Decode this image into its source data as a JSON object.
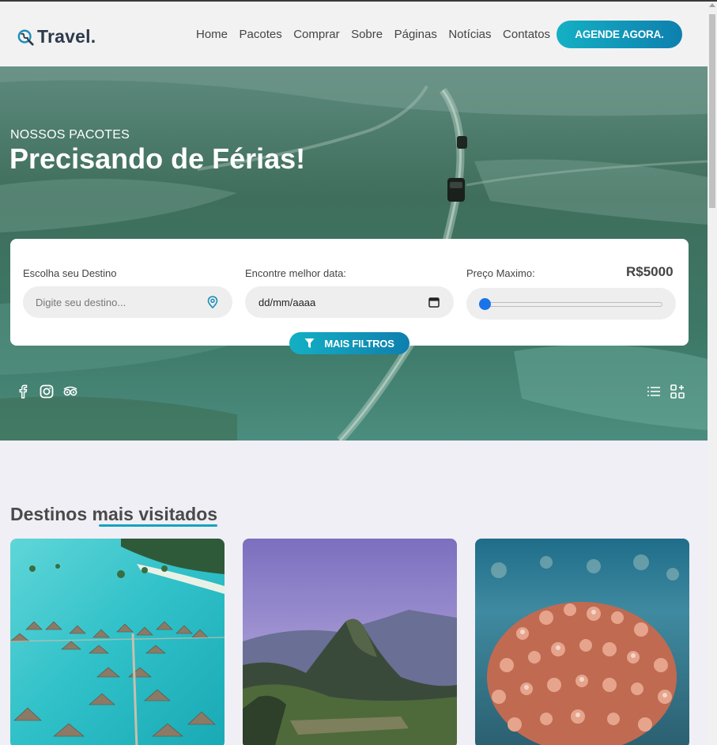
{
  "header": {
    "logo_text": "Travel.",
    "nav": [
      "Home",
      "Pacotes",
      "Comprar",
      "Sobre",
      "Páginas",
      "Notícias",
      "Contatos"
    ],
    "cta_label": "AGENDE AGORA."
  },
  "hero": {
    "subtitle": "NOSSOS PACOTES",
    "title": "Precisando de Férias!"
  },
  "search": {
    "destination_label": "Escolha seu Destino",
    "destination_placeholder": "Digite seu destino...",
    "date_label": "Encontre melhor data:",
    "date_value": "dd/mm/aaaa",
    "price_label": "Preço Maximo:",
    "price_value": "R$5000",
    "price_slider_fraction": 0.0,
    "filters_label": "MAIS FILTROS"
  },
  "social_icons": [
    "facebook-icon",
    "instagram-icon",
    "tripadvisor-icon"
  ],
  "view_icons": [
    "list-view-icon",
    "grid-add-icon"
  ],
  "section": {
    "title_start": "Destinos ",
    "title_highlight": "mais visitados"
  },
  "cards": [
    {
      "icon": "overwater-bungalows-image"
    },
    {
      "icon": "machu-picchu-image"
    },
    {
      "icon": "coral-reef-image"
    }
  ],
  "colors": {
    "accent_start": "#14b0c4",
    "accent_end": "#0e7fae",
    "background": "#f0eff5"
  }
}
